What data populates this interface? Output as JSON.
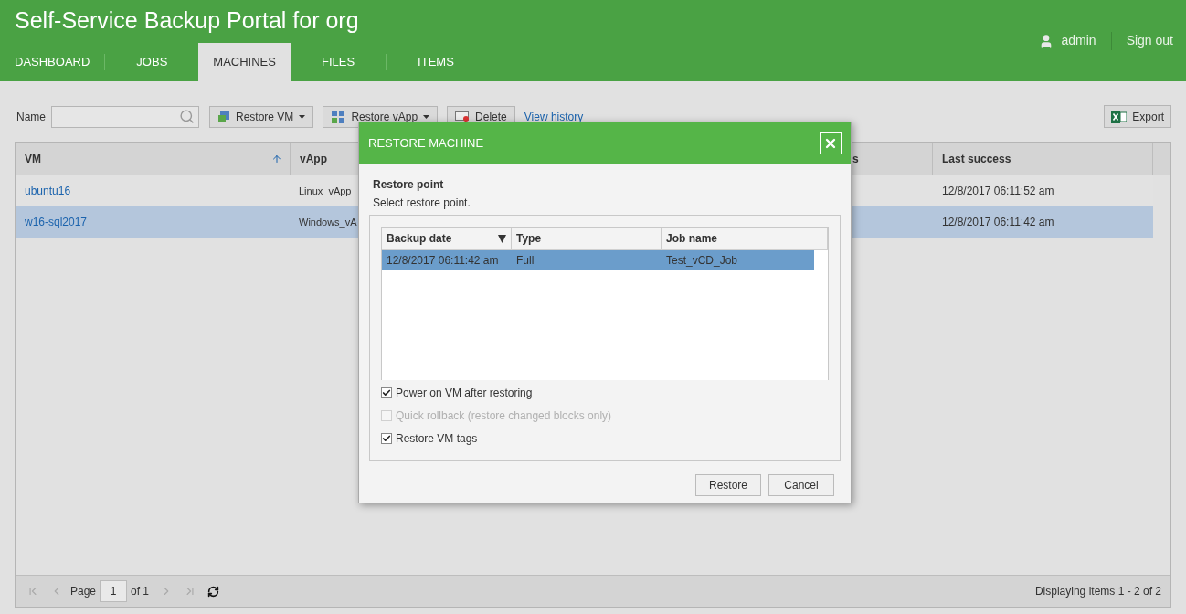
{
  "app_title": "Self-Service Backup Portal for org",
  "user": {
    "name": "admin",
    "sign_out": "Sign out"
  },
  "nav": [
    {
      "label": "DASHBOARD",
      "selected": false
    },
    {
      "label": "JOBS",
      "selected": false
    },
    {
      "label": "MACHINES",
      "selected": true
    },
    {
      "label": "FILES",
      "selected": false
    },
    {
      "label": "ITEMS",
      "selected": false
    }
  ],
  "toolbar": {
    "name_label": "Name",
    "restore_vm": "Restore VM",
    "restore_vapp": "Restore vApp",
    "delete": "Delete",
    "view_history": "View history",
    "export": "Export"
  },
  "table": {
    "columns": [
      {
        "label": "VM",
        "sorted": true
      },
      {
        "label": "vApp"
      },
      {
        "label": "s"
      },
      {
        "label": "Last success"
      }
    ],
    "rows": [
      {
        "vm": "ubuntu16",
        "vapp": "Linux_vApp",
        "last_success": "12/8/2017 06:11:52 am",
        "selected": false
      },
      {
        "vm": "w16-sql2017",
        "vapp": "Windows_vA",
        "last_success": "12/8/2017 06:11:42 am",
        "selected": true
      }
    ]
  },
  "pager": {
    "page_label": "Page",
    "page": "1",
    "of": "of 1",
    "status": "Displaying items 1 - 2 of 2"
  },
  "dialog": {
    "title": "RESTORE MACHINE",
    "section": "Restore point",
    "hint": "Select restore point.",
    "columns": [
      "Backup date",
      "Type",
      "Job name"
    ],
    "rows": [
      {
        "cells": [
          "12/8/2017 06:11:42 am",
          "Full",
          "Test_vCD_Job"
        ],
        "selected": true
      }
    ],
    "options": [
      {
        "label": "Power on VM after restoring",
        "checked": true,
        "disabled": false
      },
      {
        "label": "Quick rollback (restore changed blocks only)",
        "checked": false,
        "disabled": true
      },
      {
        "label": "Restore VM tags",
        "checked": true,
        "disabled": false
      }
    ],
    "buttons": [
      "Restore",
      "Cancel"
    ]
  }
}
